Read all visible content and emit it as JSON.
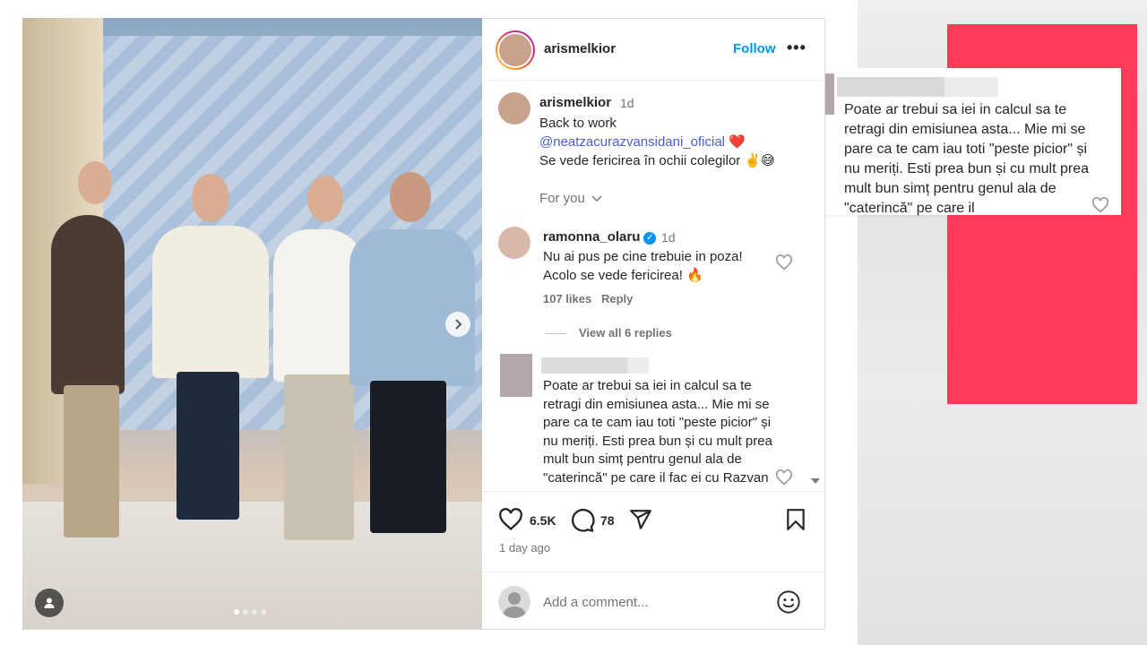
{
  "post": {
    "username": "arismelkior",
    "follow_label": "Follow",
    "more_label": "•••",
    "caption": {
      "username": "arismelkior",
      "time": "1d",
      "line1": "Back to work",
      "mention": "@neatzacurazvansidani_oficial",
      "mention_emoji": "❤️",
      "line3": "Se vede fericirea în ochii colegilor ✌️😅"
    },
    "for_you_label": "For you",
    "comments": [
      {
        "username": "ramonna_olaru",
        "verified": true,
        "time": "1d",
        "text": "Nu ai pus pe cine trebuie in poza! Acolo se vede fericirea! 🔥",
        "likes": "107 likes",
        "reply_label": "Reply",
        "view_replies": "View all 6 replies"
      },
      {
        "text": "Poate ar trebui sa iei in calcul sa te retragi din emisiunea asta... Mie mi se pare ca te cam iau toti \"peste picior\" și nu meriți. Esti prea bun și cu mult prea mult bun simț pentru genul ala de \"caterincă\" pe care il fac ei cu Razvan ...i Tzadei"
      }
    ],
    "likes_count": "6.5K",
    "comments_count": "78",
    "time_ago": "1 day ago",
    "comment_placeholder": "Add a comment..."
  },
  "zoom": {
    "text": "Poate ar trebui sa iei in calcul sa te retragi din emisiunea asta... Mie mi se pare ca te cam iau toti \"peste picior\" și nu meriți. Esti prea bun și cu mult prea mult bun simț pentru genul ala de \"caterincă\" pe care il"
  },
  "carousel": {
    "count": 4,
    "active": 1
  },
  "colors": {
    "follow": "#0095f6",
    "accent_pink": "#ff3b5c",
    "mention": "#4a5dcb"
  }
}
